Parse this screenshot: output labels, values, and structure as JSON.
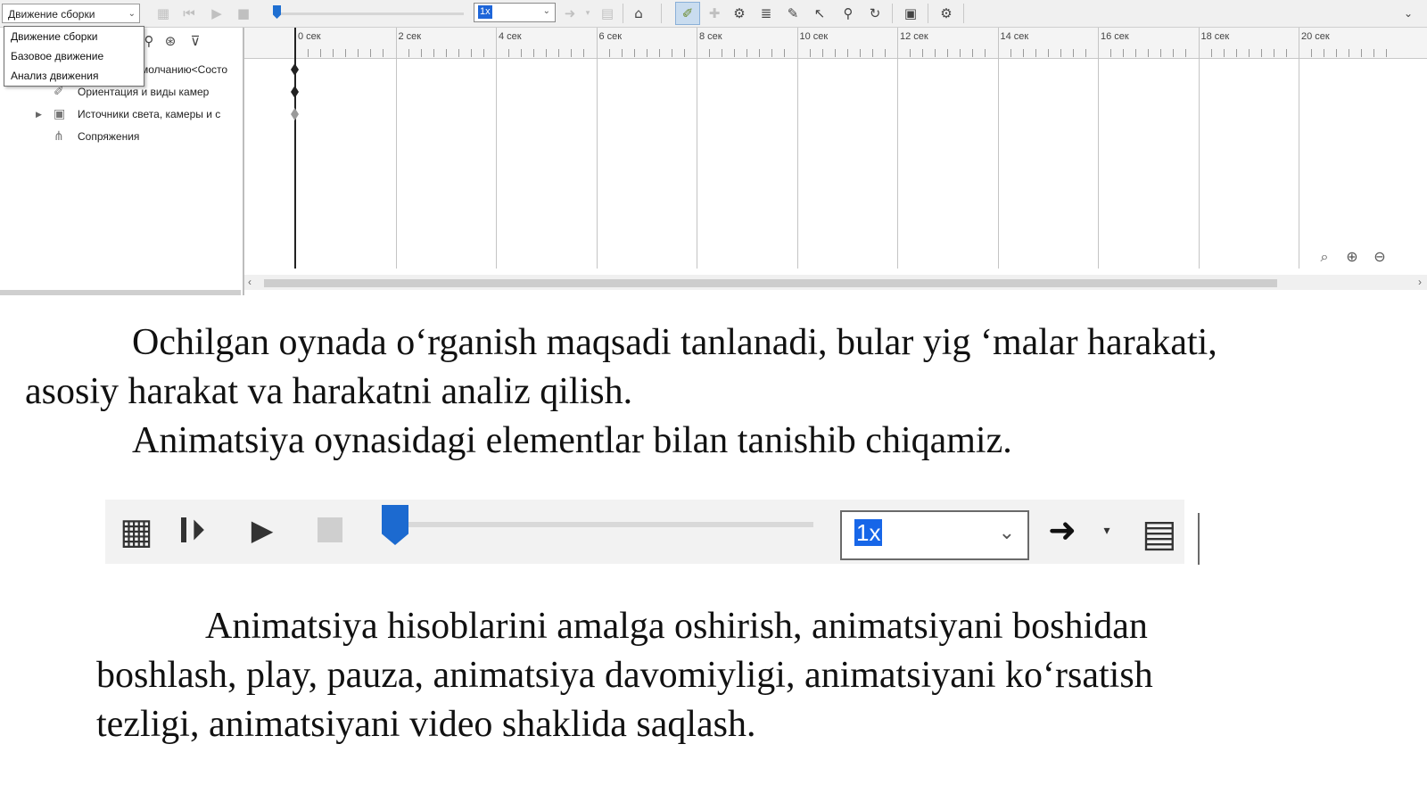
{
  "screenshot": {
    "study_select": {
      "value": "Движение сборки",
      "options": [
        "Движение сборки",
        "Базовое движение",
        "Анализ движения"
      ]
    },
    "speed": "1x",
    "tree": [
      {
        "label": "молчанию<Состо"
      },
      {
        "label": "Ориентация и виды камер"
      },
      {
        "label": "Источники света, камеры и с"
      },
      {
        "label": "Сопряжения"
      }
    ],
    "timeline_labels": [
      "0 сек",
      "2 сек",
      "4 сек",
      "6 сек",
      "8 сек",
      "10 сек",
      "12 сек",
      "14 сек",
      "16 сек",
      "18 сек",
      "20 сек"
    ],
    "icons": {
      "calculate": "table-gear-icon",
      "play_from_start": "play-from-start-icon",
      "play": "play-icon",
      "stop": "stop-icon",
      "playback_mode": "arrow-right-icon",
      "save_animation": "film-save-icon"
    }
  },
  "text": {
    "para1_line1": "Ochilgan oynada o‘rganish maqsadi tanlanadi, bular yig ‘malar harakati,",
    "para1_line2": "asosiy harakat va harakatni analiz qilish.",
    "para2": "Animatsiya oynasidagi elementlar bilan tanishib chiqamiz.",
    "para3_line1": "Animatsiya hisoblarini amalga oshirish, animatsiyani boshidan",
    "para3_line2": "boshlash, play, pauza, animatsiya davomiyligi, animatsiyani ko‘rsatish",
    "para3_line3": "tezligi, animatsiyani video shaklida saqlash."
  },
  "animation_toolbar": {
    "speed": "1x"
  },
  "colors": {
    "accent_blue": "#1c6ad0",
    "selection_blue": "#1766e8"
  }
}
